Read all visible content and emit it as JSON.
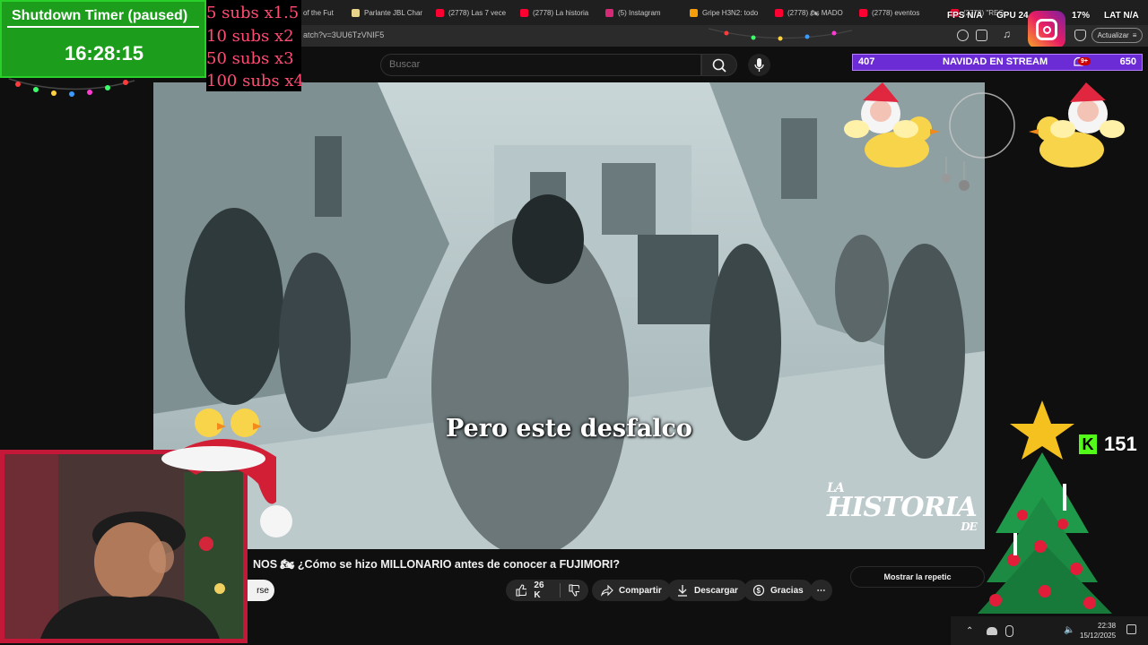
{
  "timer": {
    "title": "Shutdown Timer (paused)",
    "value": "16:28:15"
  },
  "subs": {
    "lines": [
      "5 subs x1.5",
      "10 subs x2",
      "50 subs x3",
      "100 subs x4"
    ]
  },
  "browser": {
    "tabs": [
      {
        "label": "of the Fut",
        "color": "#3c5fbf"
      },
      {
        "label": "Parlante JBL Char",
        "color": "#e7d38a"
      },
      {
        "label": "(2778) Las 7 vece",
        "color": "#ff0033"
      },
      {
        "label": "(2778) La historia",
        "color": "#ff0033"
      },
      {
        "label": "(5) Instagram",
        "color": "#d62976"
      },
      {
        "label": "Gripe H3N2: todo",
        "color": "#f59e0b"
      },
      {
        "label": "(2778) 🏍 MADO",
        "color": "#ff0033"
      },
      {
        "label": "(2778) eventos",
        "color": "#ff0033"
      },
      {
        "label": "(2778) \"REG",
        "color": "#ff0033"
      }
    ],
    "url": "atch?v=3UU6TzVNIF5",
    "update_label": "Actualizar"
  },
  "stats": {
    "fps_label": "FPS",
    "fps_value": "N/A",
    "gpu_label": "GPU",
    "gpu_value": "24",
    "cpu_value": "17%",
    "lat_label": "LAT",
    "lat_value": "N/A"
  },
  "youtube": {
    "search_placeholder": "Buscar",
    "video_title": "NOS 🏍 ¿Cómo se hizo MILLONARIO antes de conocer a FUJIMORI?",
    "subscribe_fragment": "rse",
    "likes": "26 K",
    "share_label": "Compartir",
    "download_label": "Descargar",
    "thanks_label": "Gracias",
    "more_label": "⋯",
    "show_reps_label": "Mostrar la repetic",
    "notif_count": "9+"
  },
  "video": {
    "caption": "Pero este desfalco",
    "watermark_line1": "LA",
    "watermark_line2": "HISTORIA",
    "watermark_line3": "DE"
  },
  "goal": {
    "current": "407",
    "title": "NAVIDAD EN STREAM",
    "target": "650"
  },
  "kick": {
    "logo": "K",
    "count": "151"
  },
  "taskbar": {
    "time": "22:38",
    "date": "15/12/2025"
  }
}
